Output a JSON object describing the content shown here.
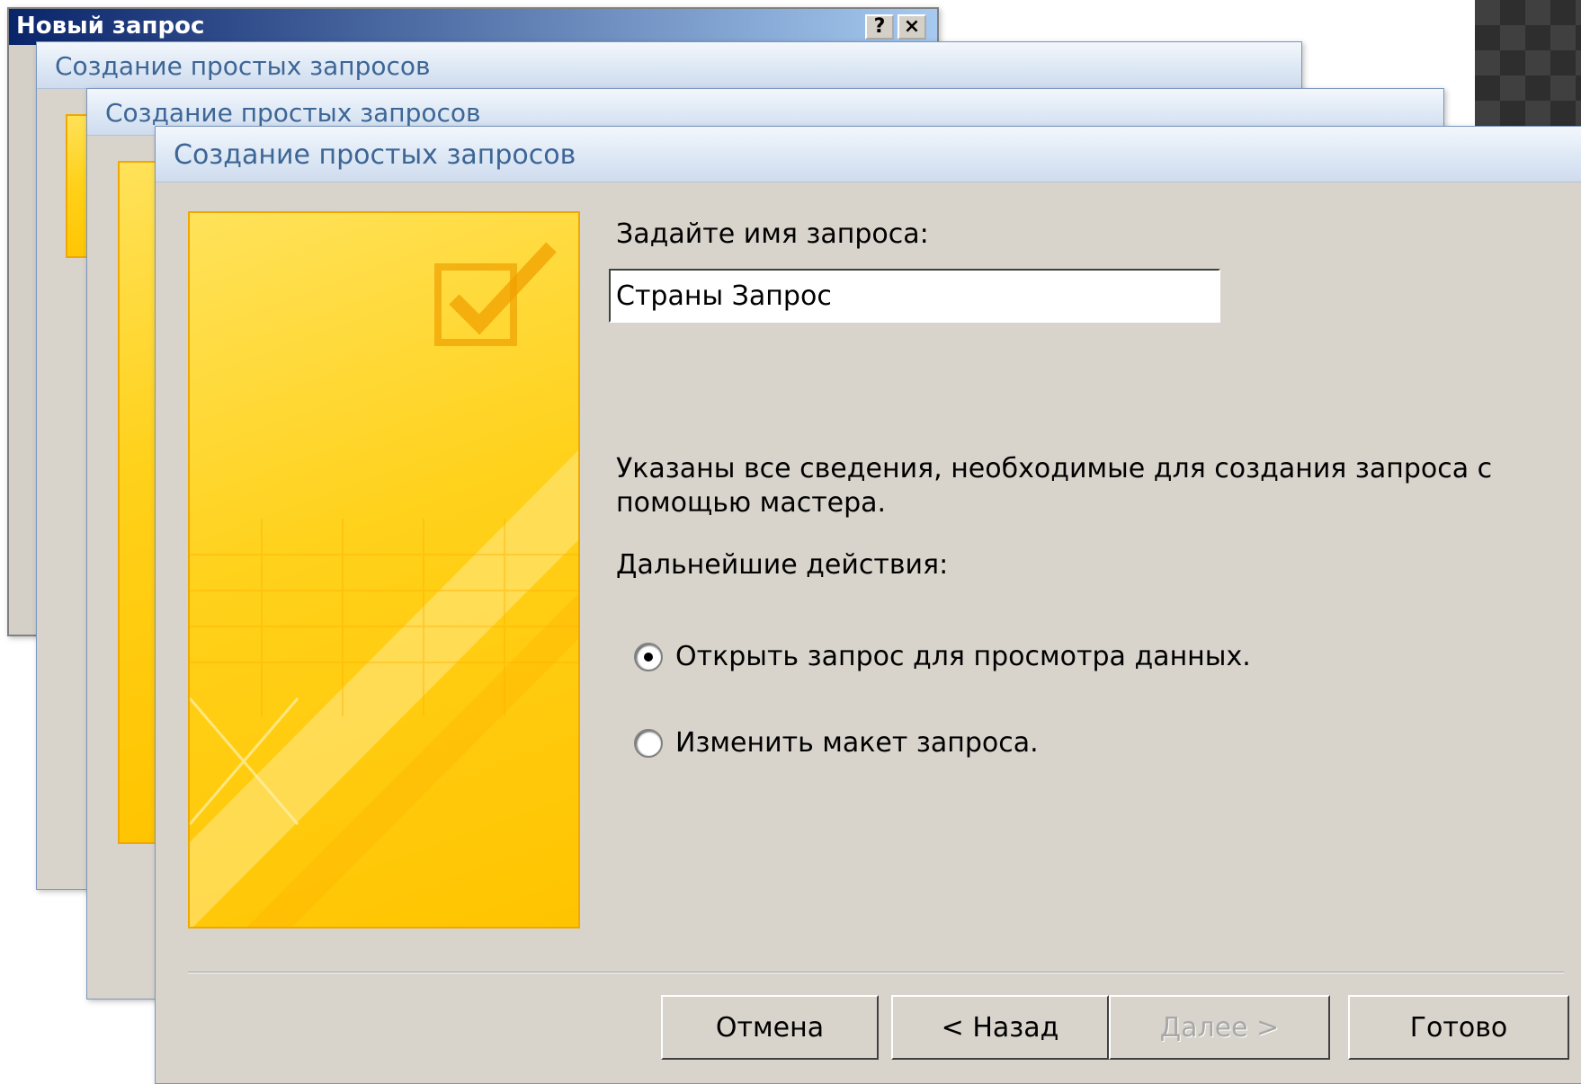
{
  "window1": {
    "title": "Новый запрос",
    "help_btn": "?",
    "close_btn": "×"
  },
  "window2": {
    "title": "Создание простых запросов"
  },
  "window3": {
    "title": "Создание простых запросов"
  },
  "dialog": {
    "title": "Создание простых запросов",
    "name_prompt": "Задайте имя запроса:",
    "query_name": "Страны Запрос",
    "info_text": "Указаны все сведения, необходимые для создания запроса с помощью мастера.",
    "next_actions_label": "Дальнейшие действия:",
    "options": [
      {
        "label": "Открыть запрос для просмотра данных.",
        "checked": true
      },
      {
        "label": "Изменить макет запроса.",
        "checked": false
      }
    ],
    "buttons": {
      "cancel": "Отмена",
      "back": "< Назад",
      "next": "Далее >",
      "finish": "Готово"
    }
  },
  "colors": {
    "wizard_panel": "#ffd11a",
    "titlebar_text": "#3d6696",
    "dialog_bg": "#d8d4cc"
  }
}
